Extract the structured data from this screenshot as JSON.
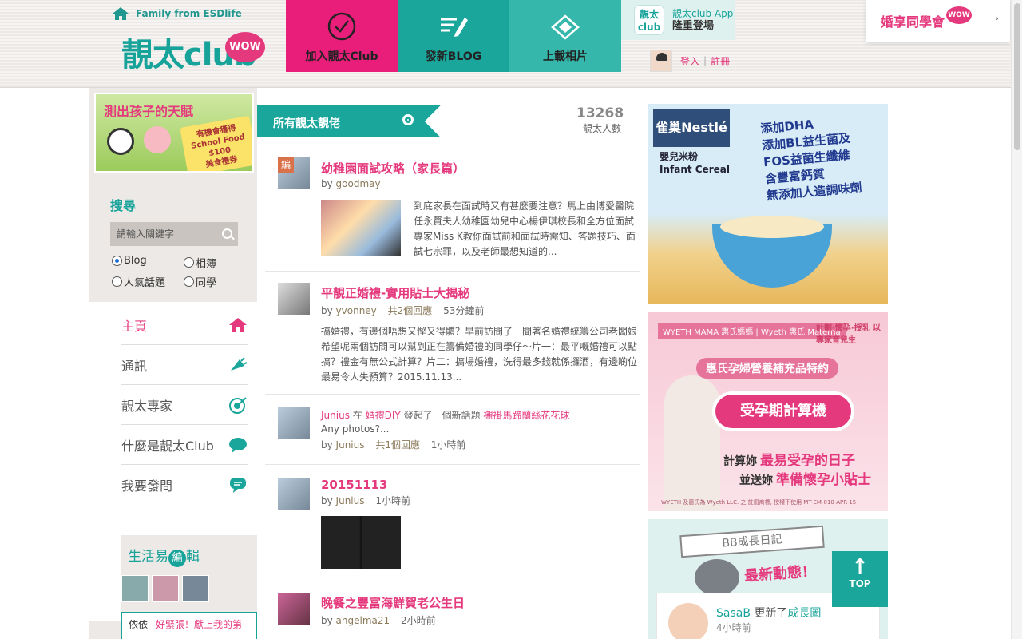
{
  "header": {
    "home_label": "Family from ESDlife",
    "logo_text": "靚太club",
    "logo_badge": "WOW",
    "buttons": {
      "join": "加入靚太Club",
      "blog": "發新BLOG",
      "photo": "上載相片"
    },
    "app": {
      "tile": "靚太 club",
      "line1": "靚太club App",
      "line2": "隆重登場"
    },
    "login": {
      "login_label": "登入",
      "separator": "|",
      "register_label": "註冊"
    },
    "promo": {
      "label": "婚享同學會",
      "badge": "WOW",
      "arrow": "›"
    }
  },
  "sidebar": {
    "ad": {
      "headline": "測出孩子的天賦",
      "sticker_line1": "有機會獲得",
      "sticker_line2": "School Food",
      "sticker_line3": "$100",
      "sticker_line4": "美食禮券"
    },
    "search": {
      "title": "搜尋",
      "placeholder": "請輸入關鍵字",
      "options": [
        "Blog",
        "相簿",
        "人氣話題",
        "同學"
      ],
      "selected": "Blog"
    },
    "nav": [
      "主頁",
      "通訊",
      "靚太專家",
      "什麼是靚太Club",
      "我要發問"
    ],
    "life": {
      "title_prefix": "生活易",
      "title_badge": "編",
      "title_suffix": "輯",
      "quote_user": "依依",
      "quote_text": "好緊張！獻上我的第"
    }
  },
  "feed": {
    "header_label": "所有靚太靚佬",
    "member_count": "13268",
    "member_label": "靚太人數",
    "posts": [
      {
        "tag": "編",
        "title": "幼稚園面試攻略（家長篇）",
        "prefix": "by",
        "author": "goodmay",
        "body": "到底家長在面試時又有甚麼要注意？馬上由博愛醫院任永賢夫人幼稚園幼兒中心楊伊琪校長和全方位面試專家Miss K教你面試前和面試時需知、答題技巧、面試七宗罪，以及老師最想知道的..."
      },
      {
        "title": "平靚正婚禮-實用貼士大揭秘",
        "prefix": "by",
        "author": "yvonney",
        "replies": "共2個回應",
        "time": "53分鐘前",
        "body": "搞婚禮，有邊個唔想又慳又得體？早前訪問了一間著名婚禮統籌公司老闆娘希望呢兩個訪問可以幫到正在籌備婚禮的同學仔～片一：最平嘅婚禮可以點搞？禮金有無公式計算？片二：搞場婚禮，洗得最多錢就係攞酒，有邊啲位最易令人失預算？2015.11.13..."
      },
      {
        "activity_user": "Junius",
        "activity_in": "在",
        "activity_group": "婚禮DIY",
        "activity_action": "發起了一個新話題",
        "activity_topic": "襯褂馬蹄蘭絲花花球",
        "body": "Any photos?...",
        "prefix": "by",
        "author": "Junius",
        "replies": "共1個回應",
        "time": "1小時前"
      },
      {
        "title": "20151113",
        "prefix": "by",
        "author": "Junius",
        "time": "1小時前"
      },
      {
        "title": "晚餐之豐富海鮮賀老公生日",
        "prefix": "by",
        "author": "angelma21",
        "time": "2小時前"
      }
    ]
  },
  "ads": {
    "nestle": {
      "brand": "雀巢Nestlé",
      "sub1": "嬰兒米粉",
      "sub2": "Infant Cereal",
      "features": [
        "添加DHA",
        "添加BL益生菌及",
        "FOS益菌生纖維",
        "含豐富鈣質",
        "無添加人造調味劑"
      ]
    },
    "wyeth": {
      "logos": "WYETH MAMA 惠氏媽媽 | Wyeth 惠氏 Materna",
      "tagline": "計劃·懷孕·授乳 以專家育兒生",
      "arc": "惠氏孕婦營養補充品特約",
      "calc": "受孕期計算機",
      "line1_prefix": "計算妳",
      "line1_hl": "最易受孕的日子",
      "line2_prefix": "並送妳",
      "line2_hl": "準備懷孕小貼士",
      "fine": "WYETH 及惠氏為 Wyeth LLC. 之 註冊商標, 授權下使用 MT-EM-010-APR-15"
    },
    "bb": {
      "banner": "BB成長日記",
      "news": "最新動態！",
      "card_user": "SasaB",
      "card_action": "更新了",
      "card_link": "成長圖",
      "card_time": "4小時前"
    }
  },
  "top_button": {
    "arrow": "↑",
    "label": "TOP"
  }
}
